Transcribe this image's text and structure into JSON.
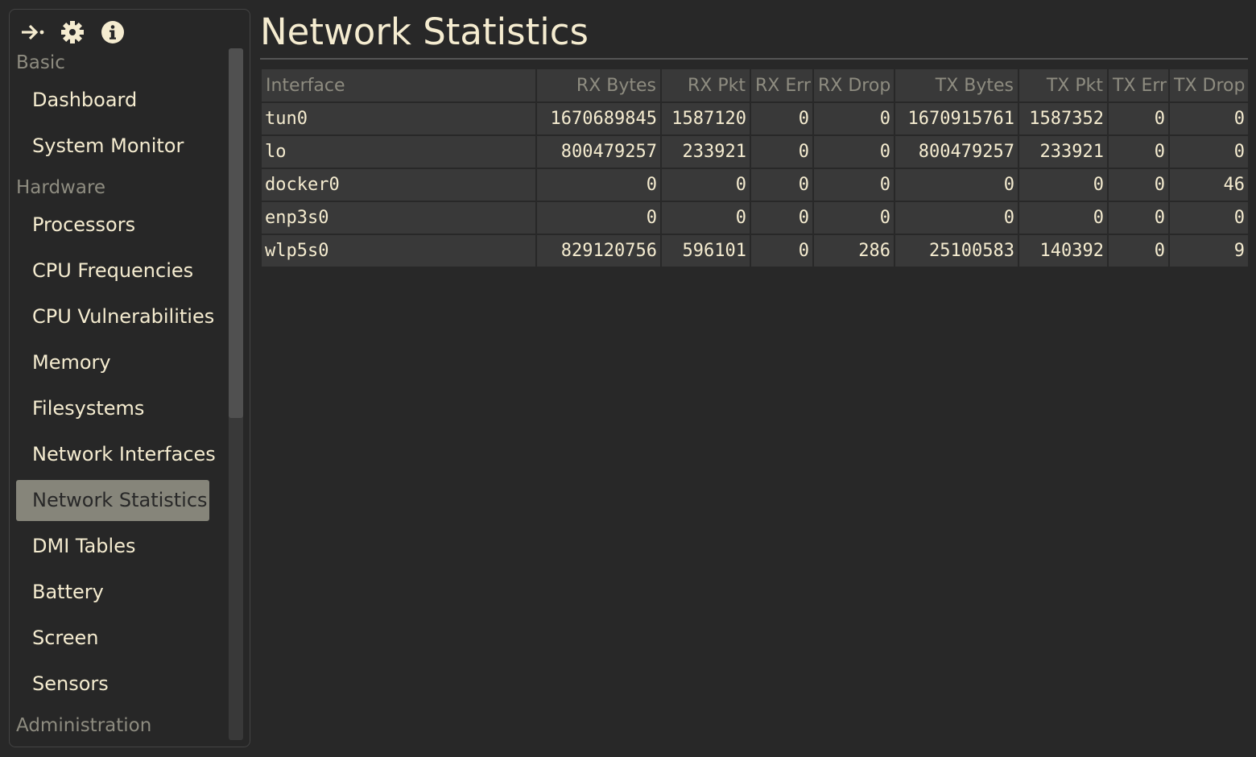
{
  "sidebar": {
    "toolbar": [
      {
        "icon": "exit-arrow-icon"
      },
      {
        "icon": "gear-icon"
      },
      {
        "icon": "info-icon"
      }
    ],
    "groups": [
      {
        "label": "Basic",
        "items": [
          {
            "label": "Dashboard"
          },
          {
            "label": "System Monitor"
          }
        ]
      },
      {
        "label": "Hardware",
        "items": [
          {
            "label": "Processors"
          },
          {
            "label": "CPU Frequencies"
          },
          {
            "label": "CPU Vulnerabilities"
          },
          {
            "label": "Memory"
          },
          {
            "label": "Filesystems"
          },
          {
            "label": "Network Interfaces"
          },
          {
            "label": "Network Statistics",
            "active": true
          },
          {
            "label": "DMI Tables"
          },
          {
            "label": "Battery"
          },
          {
            "label": "Screen"
          },
          {
            "label": "Sensors"
          }
        ]
      },
      {
        "label": "Administration",
        "items": []
      }
    ]
  },
  "main": {
    "title": "Network Statistics",
    "table": {
      "columns": [
        "Interface",
        "RX Bytes",
        "RX Pkt",
        "RX Err",
        "RX Drop",
        "TX Bytes",
        "TX Pkt",
        "TX Err",
        "TX Drop"
      ],
      "rows": [
        [
          "tun0",
          "1670689845",
          "1587120",
          "0",
          "0",
          "1670915761",
          "1587352",
          "0",
          "0"
        ],
        [
          "lo",
          "800479257",
          "233921",
          "0",
          "0",
          "800479257",
          "233921",
          "0",
          "0"
        ],
        [
          "docker0",
          "0",
          "0",
          "0",
          "0",
          "0",
          "0",
          "0",
          "46"
        ],
        [
          "enp3s0",
          "0",
          "0",
          "0",
          "0",
          "0",
          "0",
          "0",
          "0"
        ],
        [
          "wlp5s0",
          "829120756",
          "596101",
          "0",
          "286",
          "25100583",
          "140392",
          "0",
          "9"
        ]
      ]
    }
  },
  "colors": {
    "background": "#282828",
    "text": "#f5ecd0",
    "muted": "#8e8c80",
    "active": "#86857a",
    "cell": "#393939"
  }
}
